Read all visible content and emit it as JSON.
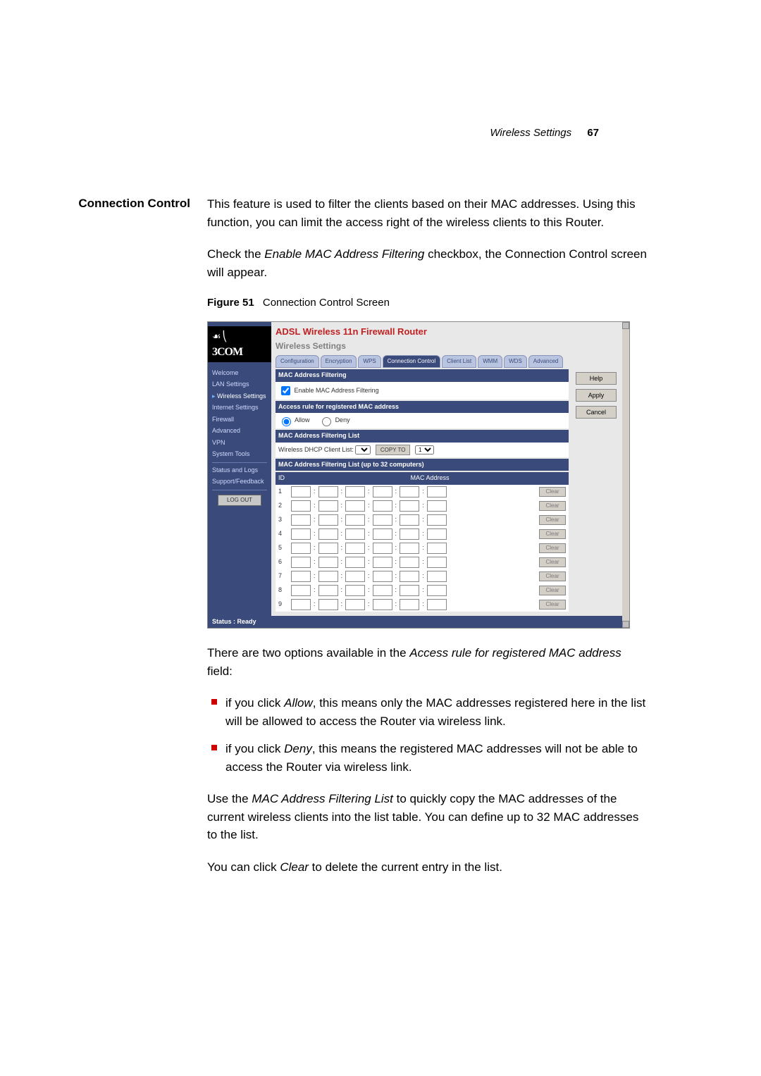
{
  "header": {
    "section": "Wireless Settings",
    "page": "67"
  },
  "sectionTitle": "Connection Control",
  "intro1": "This feature is used to filter the clients based on their MAC addresses. Using this function, you can limit the access right of the wireless clients to this Router.",
  "intro2_a": "Check the ",
  "intro2_i": "Enable MAC Address Filtering",
  "intro2_b": " checkbox, the Connection Control screen will appear.",
  "figure": {
    "label": "Figure 51",
    "caption": "Connection Control Screen"
  },
  "screenshot": {
    "logoTop": "☙⎝",
    "logo": "3COM",
    "nav": [
      "Welcome",
      "LAN Settings",
      "Wireless Settings",
      "Internet Settings",
      "Firewall",
      "Advanced",
      "VPN",
      "System Tools",
      "Status and Logs",
      "Support/Feedback"
    ],
    "navActiveIndex": 2,
    "logout": "LOG OUT",
    "title": "ADSL Wireless 11n Firewall Router",
    "subtitle": "Wireless Settings",
    "tabs": [
      "Configuration",
      "Encryption",
      "WPS",
      "Connection Control",
      "Client List",
      "WMM",
      "WDS",
      "Advanced"
    ],
    "tabActiveIndex": 3,
    "buttons": {
      "help": "Help",
      "apply": "Apply",
      "cancel": "Cancel"
    },
    "panel1": {
      "hd": "MAC Address Filtering",
      "check": "Enable MAC Address Filtering"
    },
    "panel2": {
      "hd": "Access rule for registered MAC address",
      "allow": "Allow",
      "deny": "Deny"
    },
    "panel3": {
      "hd": "MAC Address Filtering List",
      "dhcp": "Wireless DHCP Client List:",
      "copy": "COPY TO",
      "sel": "1"
    },
    "listHd": "MAC Address Filtering List (up to 32 computers)",
    "thId": "ID",
    "thMac": "MAC Address",
    "rows": [
      1,
      2,
      3,
      4,
      5,
      6,
      7,
      8,
      9
    ],
    "clear": "Clear",
    "status": "Status : Ready"
  },
  "post1_a": "There are two options available in the ",
  "post1_i": "Access rule for registered MAC address",
  "post1_b": " field:",
  "b1_a": "if you click ",
  "b1_i": "Allow",
  "b1_b": ", this means only the MAC addresses registered here in the list will be allowed to access the Router via wireless link.",
  "b2_a": "if you click ",
  "b2_i": "Deny",
  "b2_b": ", this means the registered MAC addresses will not be able to access the Router via wireless link.",
  "post2_a": "Use the ",
  "post2_i": "MAC Address Filtering List",
  "post2_b": " to quickly copy the MAC addresses of the current wireless clients into the list table. You can define up to 32 MAC addresses to the list.",
  "post3_a": "You can click ",
  "post3_i": "Clear",
  "post3_b": " to delete the current entry in the list."
}
